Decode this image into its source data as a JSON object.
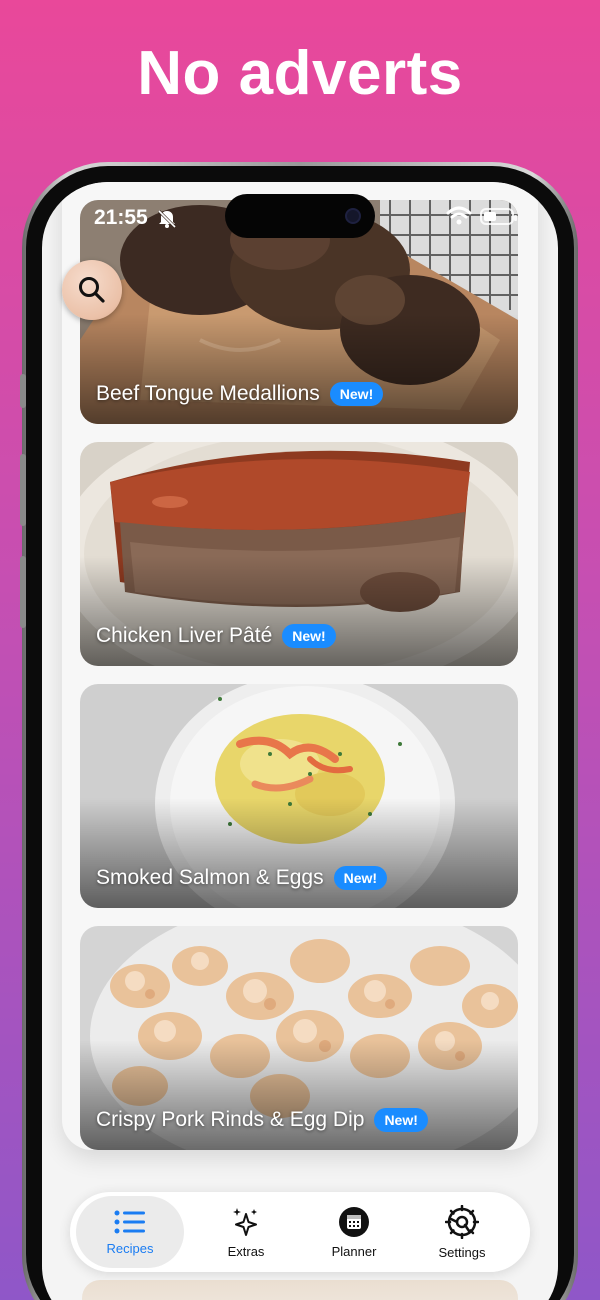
{
  "headline": "No adverts",
  "status_bar": {
    "time": "21:55"
  },
  "recipes": [
    {
      "title": "Beef Tongue Medallions",
      "badge": "New!"
    },
    {
      "title": "Chicken Liver Pâté",
      "badge": "New!"
    },
    {
      "title": "Smoked Salmon & Eggs",
      "badge": "New!"
    },
    {
      "title": "Crispy Pork Rinds & Egg Dip",
      "badge": "New!"
    }
  ],
  "tabbar": {
    "tabs": [
      {
        "label": "Recipes",
        "icon": "list-icon",
        "active": true
      },
      {
        "label": "Extras",
        "icon": "sparkles-icon",
        "active": false
      },
      {
        "label": "Planner",
        "icon": "calendar-icon",
        "active": false
      },
      {
        "label": "Settings",
        "icon": "gear-icon",
        "active": false
      }
    ]
  },
  "colors": {
    "accent": "#1a7cf2",
    "badge": "#1a8cff",
    "background_top": "#e9489a",
    "background_bottom": "#8f57c8"
  }
}
